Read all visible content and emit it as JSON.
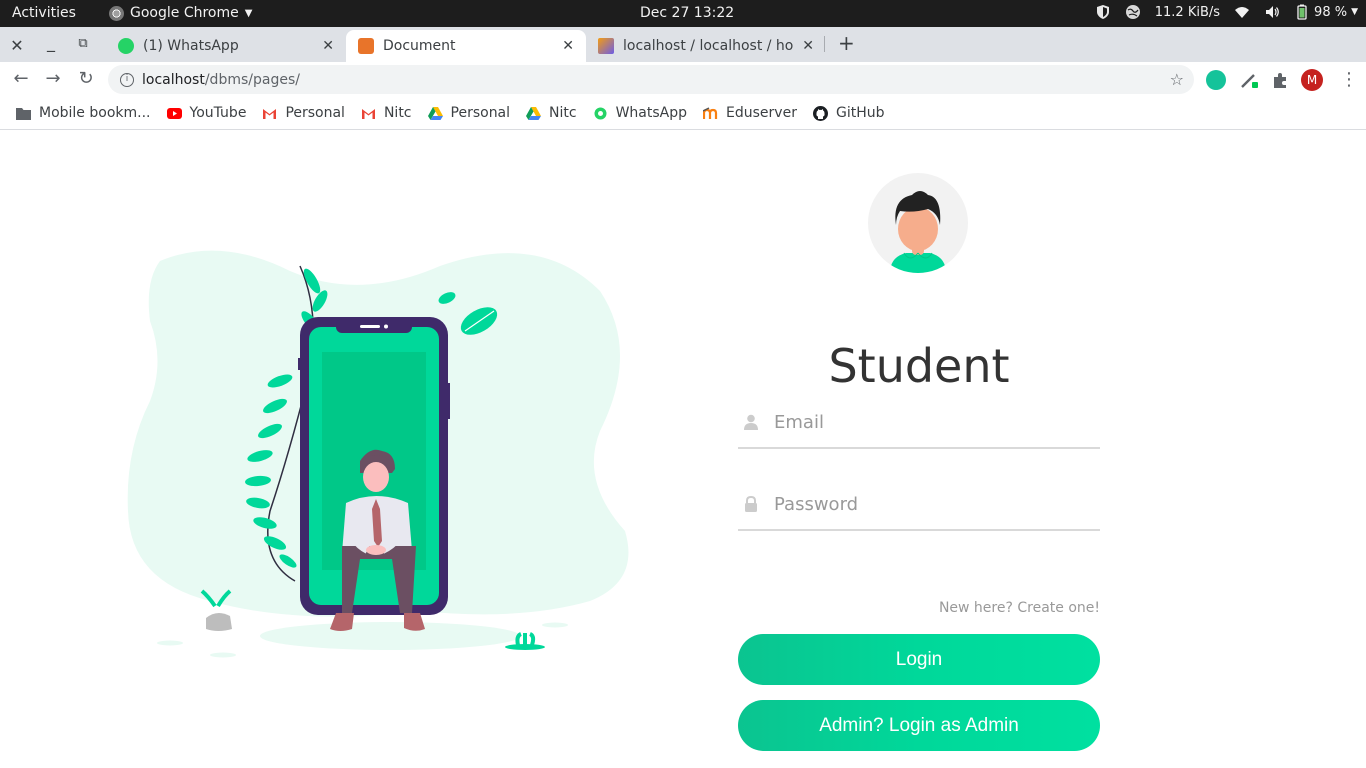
{
  "system_bar": {
    "activities": "Activities",
    "app_name": "Google Chrome",
    "clock": "Dec 27  13:22",
    "network_speed": "11.2 KiB/s",
    "battery": "98 %"
  },
  "tabs": [
    {
      "title": "(1) WhatsApp",
      "active": false
    },
    {
      "title": "Document",
      "active": true
    },
    {
      "title": "localhost / localhost / hos",
      "active": false
    }
  ],
  "address_bar": {
    "host": "localhost",
    "path": "/dbms/pages/"
  },
  "profile": {
    "initial": "M"
  },
  "bookmarks": [
    {
      "label": "Mobile bookm...",
      "icon": "folder-icon"
    },
    {
      "label": "YouTube",
      "icon": "youtube-icon"
    },
    {
      "label": "Personal",
      "icon": "gmail-icon"
    },
    {
      "label": "Nitc",
      "icon": "gmail-icon"
    },
    {
      "label": "Personal",
      "icon": "drive-icon"
    },
    {
      "label": "Nitc",
      "icon": "drive-icon"
    },
    {
      "label": "WhatsApp",
      "icon": "whatsapp-icon"
    },
    {
      "label": "Eduserver",
      "icon": "moodle-icon"
    },
    {
      "label": "GitHub",
      "icon": "github-icon"
    }
  ],
  "login": {
    "heading": "Student",
    "email_placeholder": "Email",
    "password_placeholder": "Password",
    "create_link": "New here? Create one!",
    "login_button": "Login",
    "admin_button": "Admin? Login as Admin"
  },
  "colors": {
    "accent": "#00d89a",
    "blob": "#e8faf3",
    "phone_frame": "#3f2a6a"
  }
}
